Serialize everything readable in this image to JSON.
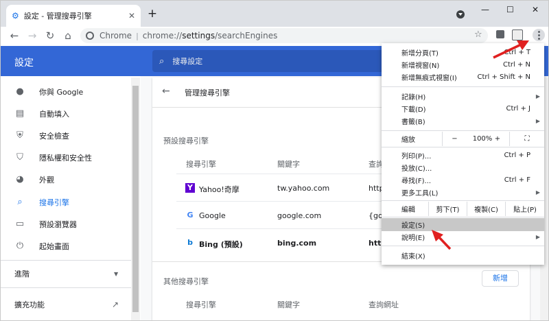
{
  "browser": {
    "tab_title": "設定 - 管理搜尋引擎",
    "tab_close": "✕",
    "new_tab": "+",
    "window_controls": [
      "—",
      "☐",
      "✕"
    ],
    "omnibox": {
      "host": "Chrome",
      "separator": "|",
      "url_prefix": "chrome://",
      "url_main": "settings",
      "url_path": "/searchEngines"
    }
  },
  "header": {
    "title": "設定",
    "search_placeholder": "搜尋設定"
  },
  "sidebar": {
    "items": [
      {
        "label": "你與 Google",
        "icon": "person-icon"
      },
      {
        "label": "自動填入",
        "icon": "clipboard-icon"
      },
      {
        "label": "安全檢查",
        "icon": "shield-check-icon"
      },
      {
        "label": "隱私權和安全性",
        "icon": "shield-icon"
      },
      {
        "label": "外觀",
        "icon": "palette-icon"
      },
      {
        "label": "搜尋引擎",
        "icon": "search-icon",
        "active": true
      },
      {
        "label": "預設瀏覽器",
        "icon": "browser-icon"
      },
      {
        "label": "起始畫面",
        "icon": "power-icon"
      }
    ],
    "advanced": "進階",
    "extensions": "擴充功能"
  },
  "page": {
    "title": "管理搜尋引擎",
    "default_section": "預設搜尋引擎",
    "other_section": "其他搜尋引擎",
    "columns": {
      "engine": "搜尋引擎",
      "keyword": "關鍵字",
      "url": "查詢網址",
      "url_partial": "查詢"
    },
    "engines": [
      {
        "name": "Yahoo!奇摩",
        "keyword": "tw.yahoo.com",
        "url": "http"
      },
      {
        "name": "Google",
        "keyword": "google.com",
        "url": "{goo"
      },
      {
        "name": "Bing (預設)",
        "keyword": "bing.com",
        "url": "http"
      }
    ],
    "add_button": "新增"
  },
  "menu": {
    "items_top": [
      {
        "label": "新增分頁(T)",
        "shortcut": "Ctrl + T"
      },
      {
        "label": "新增視窗(N)",
        "shortcut": "Ctrl + N"
      },
      {
        "label": "新增無痕式視窗(I)",
        "shortcut": "Ctrl + Shift + N"
      }
    ],
    "items_hist": [
      {
        "label": "記錄(H)",
        "shortcut": "",
        "arrow": "▶"
      },
      {
        "label": "下載(D)",
        "shortcut": "Ctrl + J"
      },
      {
        "label": "書籤(B)",
        "shortcut": "",
        "arrow": "▶"
      }
    ],
    "zoom": {
      "label": "縮放",
      "minus": "−",
      "value": "100%",
      "plus": "+",
      "fullscreen": "⛶"
    },
    "items_tools": [
      {
        "label": "列印(P)...",
        "shortcut": "Ctrl + P"
      },
      {
        "label": "投放(C)...",
        "shortcut": ""
      },
      {
        "label": "尋找(F)...",
        "shortcut": "Ctrl + F"
      },
      {
        "label": "更多工具(L)",
        "shortcut": "",
        "arrow": "▶"
      }
    ],
    "edit": {
      "label": "編輯",
      "cut": "剪下(T)",
      "copy": "複製(C)",
      "paste": "貼上(P)"
    },
    "items_bottom": [
      {
        "label": "設定(S)",
        "shortcut": "",
        "highlight": true
      },
      {
        "label": "說明(E)",
        "shortcut": "",
        "arrow": "▶"
      }
    ],
    "exit": "結束(X)"
  },
  "colors": {
    "accent": "#3367d6",
    "annotation_arrow": "#e02020",
    "link": "#1a73e8"
  }
}
